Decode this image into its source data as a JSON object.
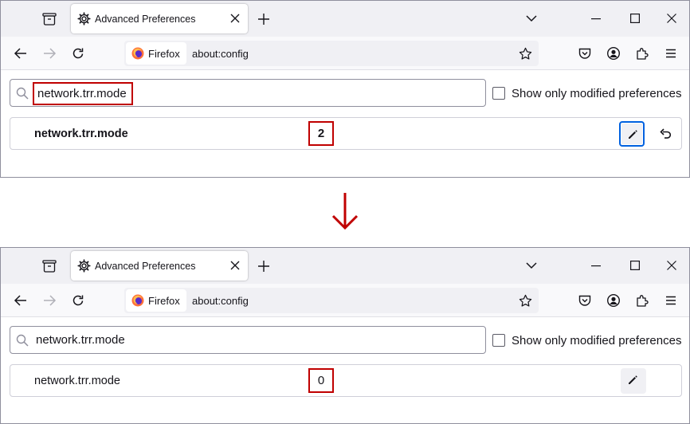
{
  "panels": [
    {
      "tab_title": "Advanced Preferences",
      "identity_label": "Firefox",
      "url": "about:config",
      "search_value": "network.trr.mode",
      "checkbox_label": "Show only modified preferences",
      "pref_name": "network.trr.mode",
      "pref_value": "2",
      "modified": true
    },
    {
      "tab_title": "Advanced Preferences",
      "identity_label": "Firefox",
      "url": "about:config",
      "search_value": "network.trr.mode",
      "checkbox_label": "Show only modified preferences",
      "pref_name": "network.trr.mode",
      "pref_value": "0",
      "modified": false
    }
  ],
  "colors": {
    "highlight_border": "#c00000",
    "arrow": "#c00000",
    "focus_ring": "#0061e0",
    "tabbar_bg": "#f0f0f4"
  },
  "icons": [
    "tab-collection-icon",
    "gear-icon",
    "close-icon",
    "plus-icon",
    "chevron-down-icon",
    "minimize-icon",
    "maximize-icon",
    "window-close-icon",
    "back-icon",
    "forward-icon",
    "reload-icon",
    "firefox-logo-icon",
    "star-icon",
    "pocket-icon",
    "account-icon",
    "extensions-icon",
    "menu-icon",
    "search-icon",
    "pencil-icon",
    "undo-icon",
    "down-arrow-icon"
  ]
}
